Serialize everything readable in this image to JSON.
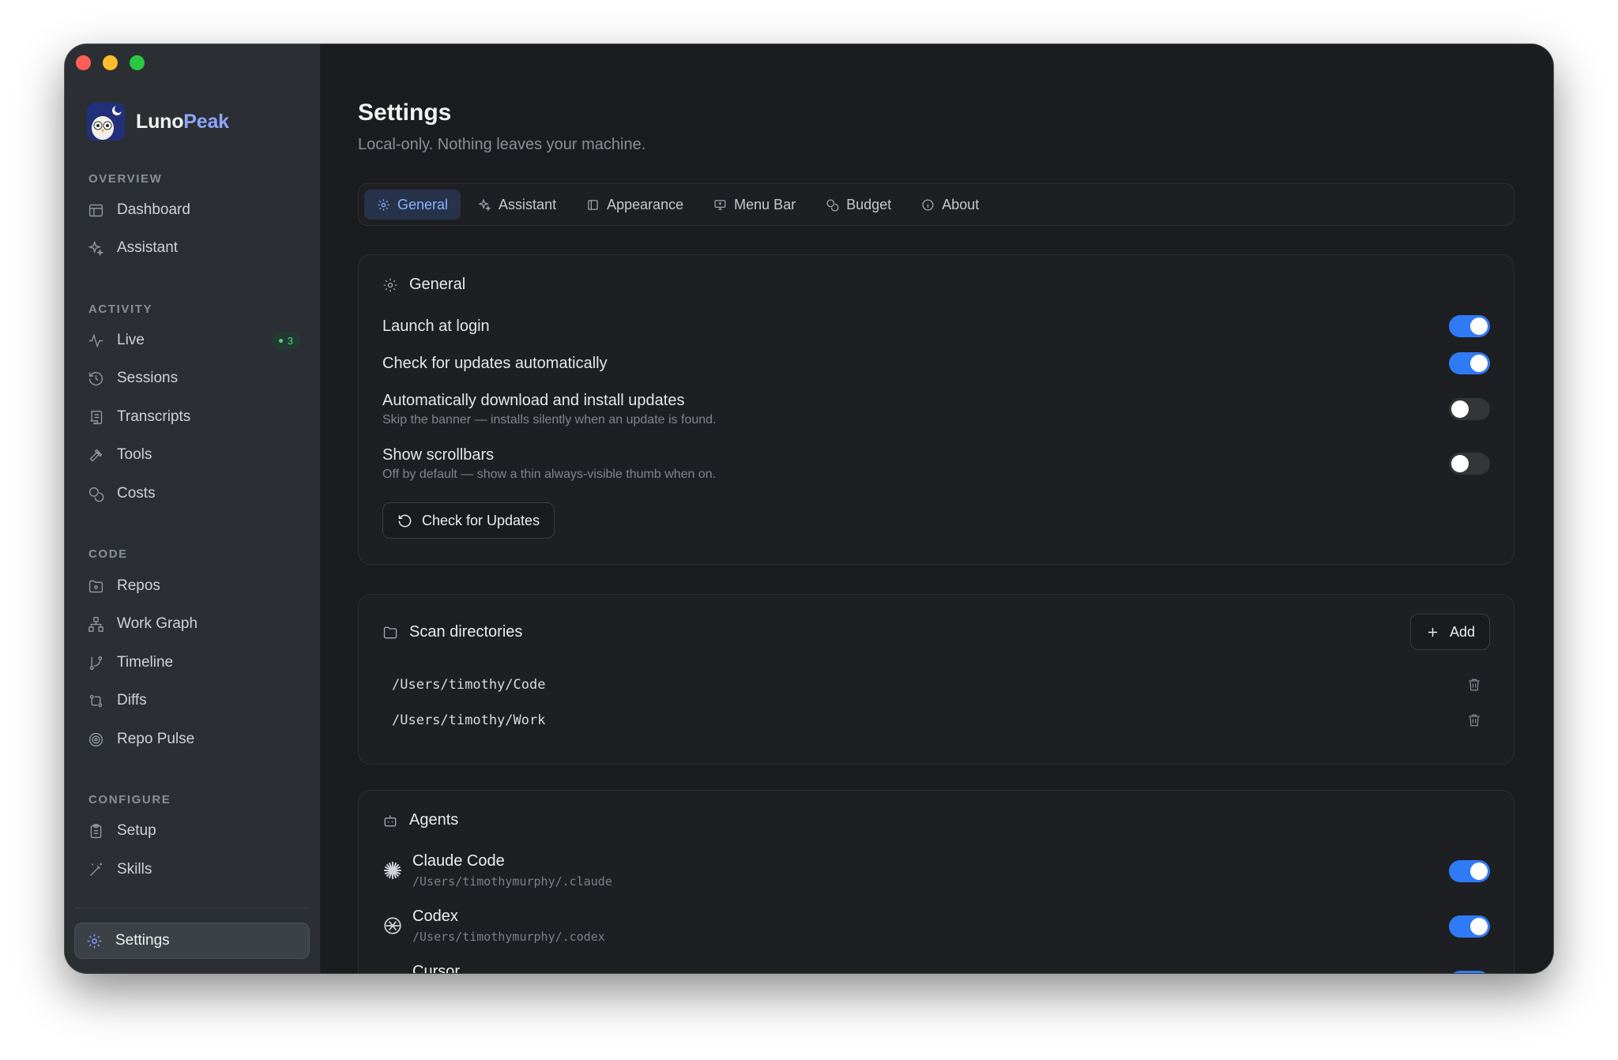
{
  "app": {
    "name_part1": "Luno",
    "name_part2": "Peak"
  },
  "colors": {
    "accent": "#2f7bf6",
    "tab_active_text": "#8fb2ff",
    "live_badge": "#4dd38a"
  },
  "sidebar": {
    "sections": [
      {
        "label": "OVERVIEW",
        "items": [
          {
            "label": "Dashboard",
            "icon": "layout-icon"
          },
          {
            "label": "Assistant",
            "icon": "sparkle-icon"
          }
        ]
      },
      {
        "label": "ACTIVITY",
        "items": [
          {
            "label": "Live",
            "icon": "pulse-icon",
            "badge": "3"
          },
          {
            "label": "Sessions",
            "icon": "history-icon"
          },
          {
            "label": "Transcripts",
            "icon": "scroll-icon"
          },
          {
            "label": "Tools",
            "icon": "hammer-icon"
          },
          {
            "label": "Costs",
            "icon": "coins-icon"
          }
        ]
      },
      {
        "label": "CODE",
        "items": [
          {
            "label": "Repos",
            "icon": "folder-git-icon"
          },
          {
            "label": "Work Graph",
            "icon": "network-icon"
          },
          {
            "label": "Timeline",
            "icon": "git-branch-icon"
          },
          {
            "label": "Diffs",
            "icon": "git-compare-icon"
          },
          {
            "label": "Repo Pulse",
            "icon": "radar-icon"
          }
        ]
      },
      {
        "label": "CONFIGURE",
        "items": [
          {
            "label": "Setup",
            "icon": "clipboard-icon"
          },
          {
            "label": "Skills",
            "icon": "wand-icon"
          }
        ]
      }
    ],
    "settings": {
      "label": "Settings",
      "icon": "gear-icon"
    }
  },
  "page": {
    "title": "Settings",
    "subtitle": "Local-only. Nothing leaves your machine."
  },
  "tabs": [
    {
      "label": "General",
      "icon": "gear-icon",
      "active": true
    },
    {
      "label": "Assistant",
      "icon": "sparkle-icon"
    },
    {
      "label": "Appearance",
      "icon": "panel-icon"
    },
    {
      "label": "Menu Bar",
      "icon": "monitor-icon"
    },
    {
      "label": "Budget",
      "icon": "coins-icon"
    },
    {
      "label": "About",
      "icon": "info-icon"
    }
  ],
  "general": {
    "title": "General",
    "rows": [
      {
        "label": "Launch at login",
        "desc": "",
        "on": true
      },
      {
        "label": "Check for updates automatically",
        "desc": "",
        "on": true
      },
      {
        "label": "Automatically download and install updates",
        "desc": "Skip the banner — installs silently when an update is found.",
        "on": false
      },
      {
        "label": "Show scrollbars",
        "desc": "Off by default — show a thin always-visible thumb when on.",
        "on": false
      }
    ],
    "check_button": "Check for Updates"
  },
  "scan": {
    "title": "Scan directories",
    "add_button": "Add",
    "dirs": [
      "/Users/timothy/Code",
      "/Users/timothy/Work"
    ]
  },
  "agents": {
    "title": "Agents",
    "items": [
      {
        "name": "Claude Code",
        "path": "/Users/timothymurphy/.claude",
        "on": true
      },
      {
        "name": "Codex",
        "path": "/Users/timothymurphy/.codex",
        "on": true
      },
      {
        "name": "Cursor",
        "path": "",
        "on": true
      }
    ]
  }
}
